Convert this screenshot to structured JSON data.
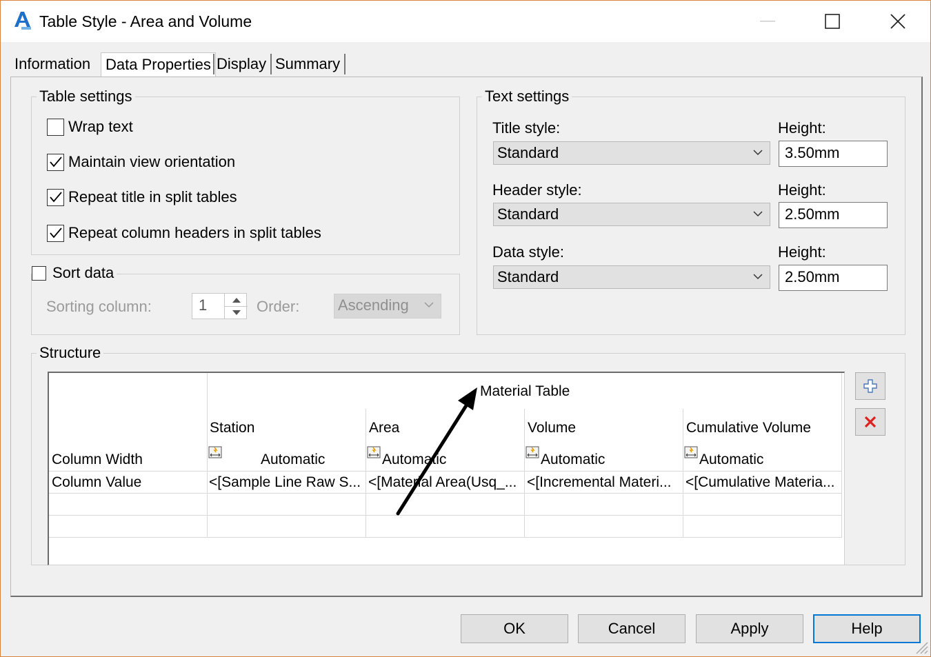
{
  "window": {
    "title": "Table Style - Area and Volume"
  },
  "tabs": [
    "Information",
    "Data Properties",
    "Display",
    "Summary"
  ],
  "table_settings": {
    "label": "Table settings",
    "options": [
      {
        "label": "Wrap text",
        "checked": false
      },
      {
        "label": "Maintain view orientation",
        "checked": true
      },
      {
        "label": "Repeat title in split tables",
        "checked": true
      },
      {
        "label": "Repeat column headers in split tables",
        "checked": true
      }
    ]
  },
  "sort": {
    "label": "Sort data",
    "checked": false,
    "sorting_column_label": "Sorting column:",
    "sorting_column_value": "1",
    "order_label": "Order:",
    "order_value": "Ascending"
  },
  "text_settings": {
    "label": "Text settings",
    "rows": [
      {
        "style_label": "Title style:",
        "style_value": "Standard",
        "height_label": "Height:",
        "height_value": "3.50mm"
      },
      {
        "style_label": "Header style:",
        "style_value": "Standard",
        "height_label": "Height:",
        "height_value": "2.50mm"
      },
      {
        "style_label": "Data style:",
        "style_value": "Standard",
        "height_label": "Height:",
        "height_value": "2.50mm"
      }
    ]
  },
  "structure": {
    "label": "Structure",
    "table_title": "Material Table",
    "row_labels": {
      "width": "Column Width",
      "value": "Column Value"
    },
    "columns": [
      {
        "header": "Station",
        "width": "Automatic",
        "value": "<[Sample Line Raw S..."
      },
      {
        "header": "Area",
        "width": "Automatic",
        "value": "<[Material Area(Usq_..."
      },
      {
        "header": "Volume",
        "width": "Automatic",
        "value": "<[Incremental Materi..."
      },
      {
        "header": "Cumulative Volume",
        "width": "Automatic",
        "value": "<[Cumulative Materia..."
      }
    ]
  },
  "buttons": {
    "ok": "OK",
    "cancel": "Cancel",
    "apply": "Apply",
    "help": "Help"
  },
  "colors": {
    "accent": "#0078d7",
    "window_border": "#d9823b",
    "delete_red": "#e02020"
  }
}
